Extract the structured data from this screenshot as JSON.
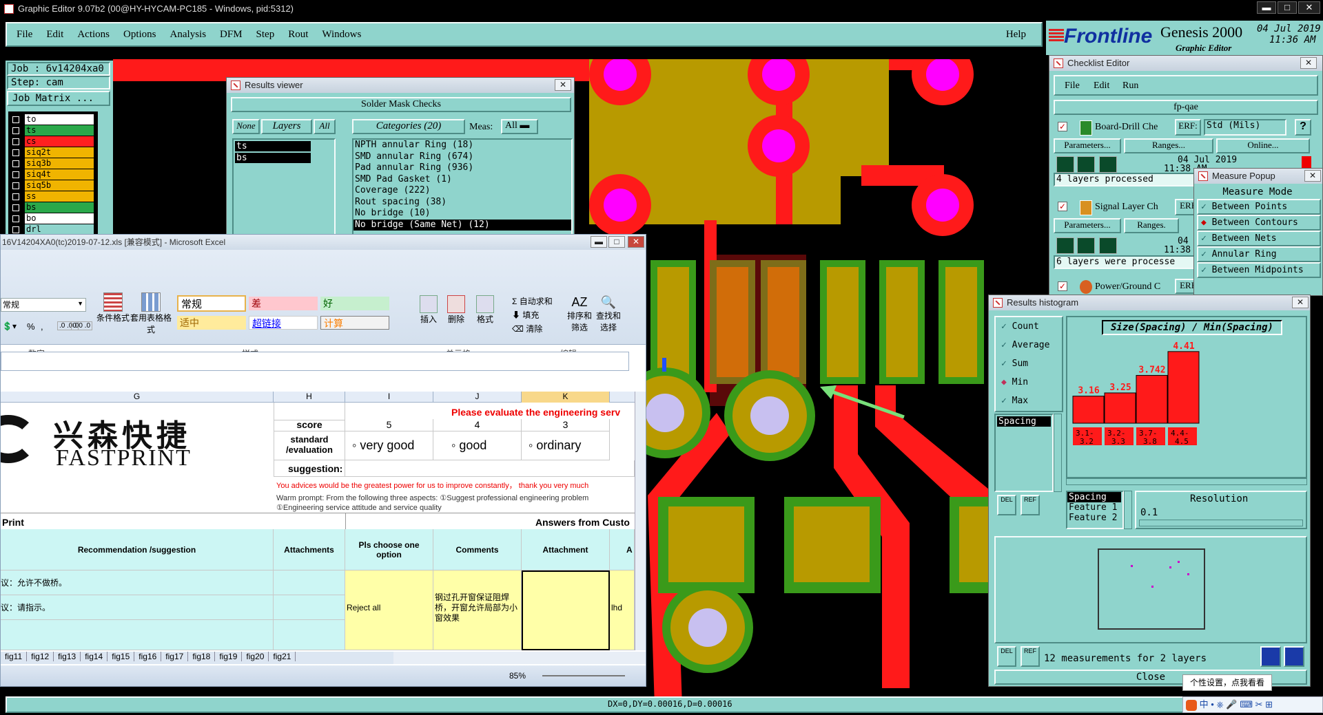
{
  "window": {
    "title": "Graphic Editor 9.07b2 (00@HY-HYCAM-PC185 - Windows, pid:5312)"
  },
  "menu": [
    "File",
    "Edit",
    "Actions",
    "Options",
    "Analysis",
    "DFM",
    "Step",
    "Rout",
    "Windows"
  ],
  "help": "Help",
  "brand": {
    "logo": "Frontline",
    "product": "Genesis 2000",
    "sub": "Graphic Editor",
    "date": "04 Jul 2019",
    "time": "11:36 AM"
  },
  "job": {
    "job": "Job : 6v14204xa0",
    "step": "Step: cam",
    "matrix": "Job Matrix ..."
  },
  "layers": [
    {
      "name": "to",
      "color": "#ffffff"
    },
    {
      "name": "ts",
      "color": "#2aa84a"
    },
    {
      "name": "cs",
      "color": "#ff2020"
    },
    {
      "name": "siq2t",
      "color": "#f0b400"
    },
    {
      "name": "siq3b",
      "color": "#f0b400"
    },
    {
      "name": "siq4t",
      "color": "#f0b400"
    },
    {
      "name": "siq5b",
      "color": "#f0b400"
    },
    {
      "name": "ss",
      "color": "#f0b400"
    },
    {
      "name": "bs",
      "color": "#2aa84a"
    },
    {
      "name": "bo",
      "color": "#ffffff"
    },
    {
      "name": "drl",
      "color": "#8fd4cc"
    }
  ],
  "results_viewer": {
    "title": "Results viewer",
    "header": "Solder Mask Checks",
    "none": "None",
    "layers": "Layers",
    "all": "All",
    "categories": "Categories (20)",
    "meas": "Meas:",
    "meas_val": "All",
    "layer_list": [
      "ts",
      "bs"
    ],
    "items": [
      "NPTH annular Ring (18)",
      "SMD annular Ring (674)",
      "Pad annular Ring (936)",
      "SMD Pad Gasket (1)",
      "Coverage (222)",
      "Rout spacing (38)",
      "No bridge (10)",
      "No bridge (Same Net) (12)"
    ]
  },
  "excel": {
    "title": "16V14204XA0(tc)2019-07-12.xls [兼容模式] - Microsoft Excel",
    "ribbon": {
      "numfmt": "常规",
      "num_group": "数字",
      "cond": "条件格式",
      "table": "套用表格格式",
      "styles_group": "样式",
      "st_normal": "常规",
      "st_bad": "差",
      "st_good": "好",
      "st_neutral": "适中",
      "st_link": "超链接",
      "st_calc": "计算",
      "insert": "插入",
      "delete": "删除",
      "format": "格式",
      "cells_group": "单元格",
      "autosum": "自动求和",
      "fill": "填充",
      "clear": "清除",
      "sort": "排序和筛选",
      "find": "查找和选择",
      "edit_group": "编辑",
      "pct": "%",
      "comma": ","
    },
    "cols": [
      "G",
      "H",
      "I",
      "J",
      "K"
    ],
    "logo_cn": "兴森快捷",
    "logo_en": "FASTPRINT",
    "score": "score",
    "s5": "5",
    "s4": "4",
    "s3": "3",
    "standard": "standard /evaluation",
    "very_good": "very good",
    "good": "good",
    "ordinary": "ordinary",
    "suggestion": "suggestion:",
    "please": "Please evaluate the engineering serv",
    "advice": "You advices would be the greatest power for us to improve constantly，  thank you very much",
    "warm1": "Warm prompt:  From the following three aspects:  ①Suggest professional engineering problem",
    "warm2": "①Engineering service attitude and service quality",
    "print": "Print",
    "answers": "Answers from Custo",
    "h_rec": "Recommendation /suggestion",
    "h_att": "Attachments",
    "h_opt": "Pls choose one option",
    "h_com": "Comments",
    "h_attach": "Attachment",
    "h_a": "A",
    "r1": "议：允许不做桥。",
    "r2": "议：请指示。",
    "reject": "Reject all",
    "comment": "钢过孔开窗保证阻焊桥，开窗允许局部为小窗效果",
    "ihd": "lhd",
    "sheets": [
      "fig11",
      "fig12",
      "fig13",
      "fig14",
      "fig15",
      "fig16",
      "fig17",
      "fig18",
      "fig19",
      "fig20",
      "fig21"
    ],
    "zoom": "85%"
  },
  "checklist": {
    "title": "Checklist Editor",
    "menu": [
      "File",
      "Edit",
      "Run"
    ],
    "name": "fp-qae",
    "c1": {
      "name": "Board-Drill Che",
      "erf": "ERF:",
      "std": "Std (Mils)",
      "q": "?",
      "params": "Parameters...",
      "ranges": "Ranges...",
      "online": "Online...",
      "date": "04 Jul 2019",
      "time": "11:38 AM -",
      "status": "4 layers processed"
    },
    "c2": {
      "name": "Signal Layer Ch",
      "erf": "ERF",
      "params": "Parameters...",
      "ranges": "Ranges.",
      "date": "04 Jul",
      "time": "11:38 AM -",
      "status": "6 layers were processe"
    },
    "c3": {
      "name": "Power/Ground C",
      "erf": "ERF"
    }
  },
  "measure": {
    "title": "Measure Popup",
    "mode": "Measure Mode",
    "items": [
      "Between Points",
      "Between Contours",
      "Between Nets",
      "Annular Ring",
      "Between Midpoints"
    ]
  },
  "histogram": {
    "title": "Results histogram",
    "opts": [
      "Count",
      "Average",
      "Sum",
      "Min",
      "Max"
    ],
    "selected": "Min",
    "list": "Spacing",
    "chart_title": "Size(Spacing) / Min(Spacing)",
    "resolution": "Resolution",
    "res_val": "0.1",
    "features": [
      "Spacing",
      "Feature 1",
      "Feature 2"
    ],
    "footer": "12 measurements for 2 layers",
    "close": "Close",
    "del": "DEL",
    "ref": "REF"
  },
  "chart_data": {
    "type": "bar",
    "title": "Size(Spacing) / Min(Spacing)",
    "categories": [
      "3.1-3.2",
      "3.2-3.3",
      "3.7-3.8",
      "4.4-4.5"
    ],
    "values": [
      3.16,
      3.25,
      3.742,
      4.41
    ],
    "ylim": [
      0,
      4.6
    ]
  },
  "status": {
    "coords": "DX=0,DY=0.00016,D=0.00016",
    "ime": "个性设置，点我看看"
  },
  "colors": {
    "teal": "#8fd4cc",
    "copper": "#b89a00",
    "red": "#ff1a1a",
    "green": "#3a9a1a",
    "pad": "#ff00ff"
  }
}
